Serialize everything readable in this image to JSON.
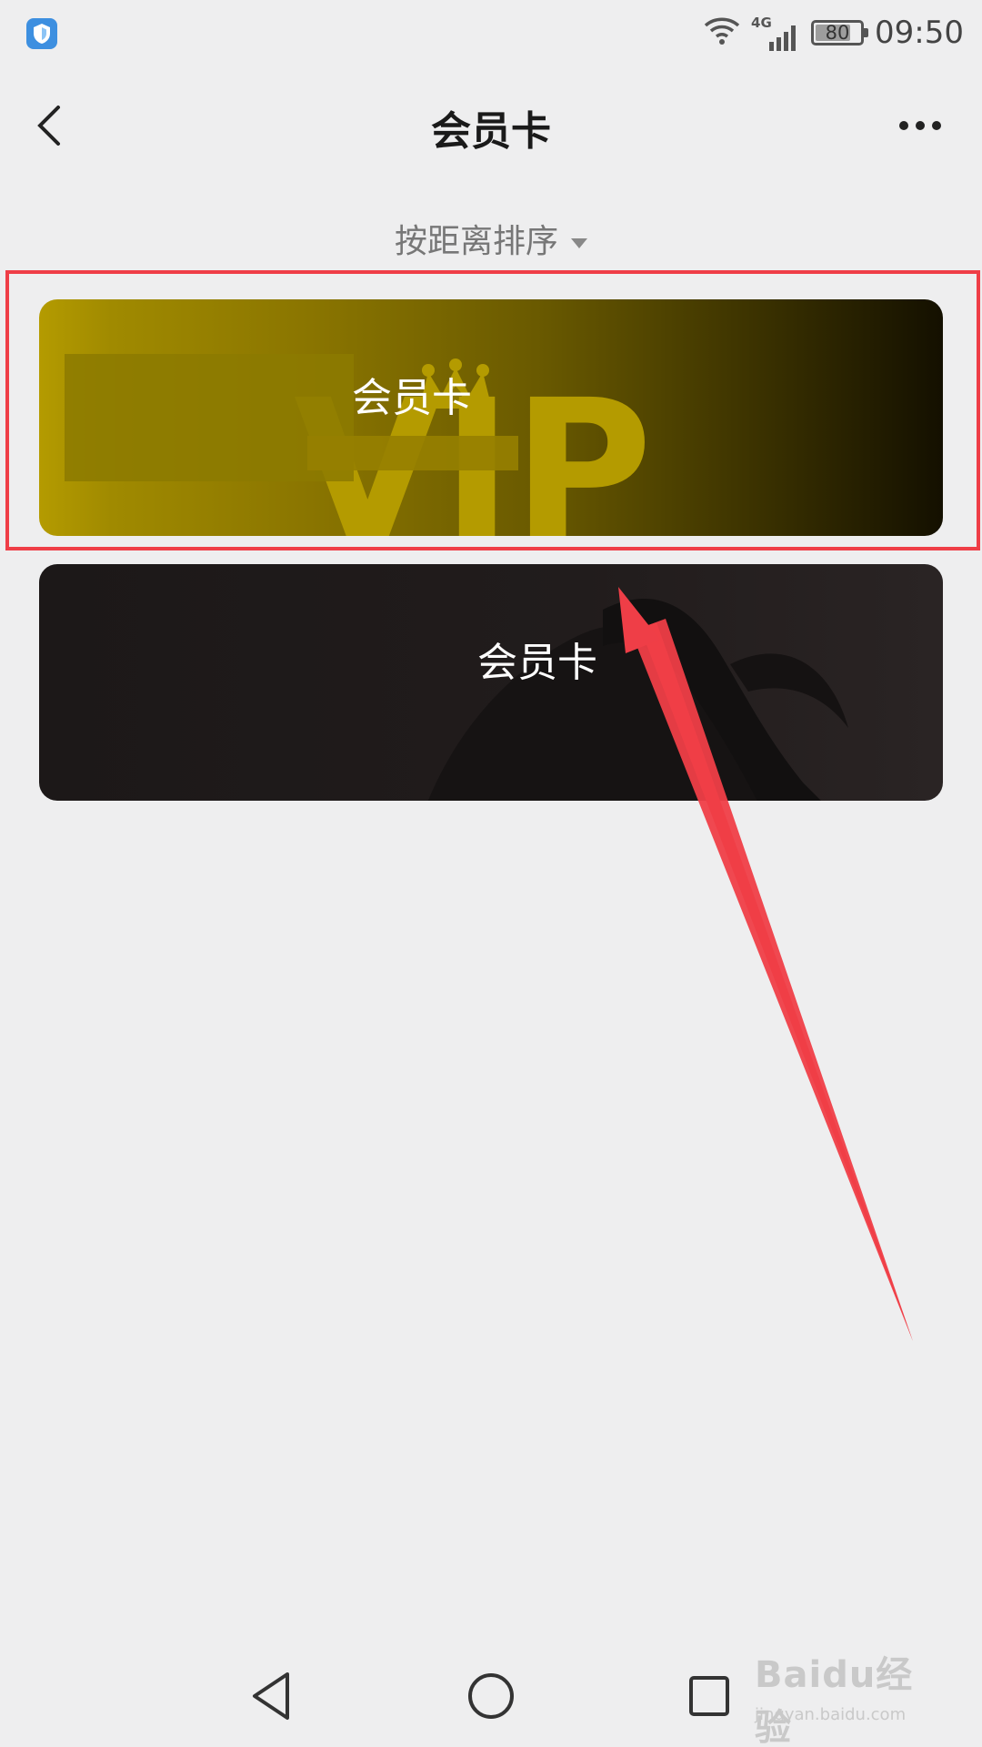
{
  "status_bar": {
    "network": "4G",
    "battery": "80",
    "battery_level": 0.8,
    "time": "09:50"
  },
  "nav": {
    "title": "会员卡"
  },
  "sort": {
    "label": "按距离排序"
  },
  "cards": [
    {
      "label": "会员卡",
      "vip_text": "VIP"
    },
    {
      "label": "会员卡"
    }
  ],
  "watermark": {
    "brand": "Baidu经验",
    "url": "jingyan.baidu.com"
  },
  "colors": {
    "highlight": "#ef3e47",
    "gold_card": "#b49b00",
    "dark_card": "#1c1818",
    "background": "#eeeeef"
  }
}
